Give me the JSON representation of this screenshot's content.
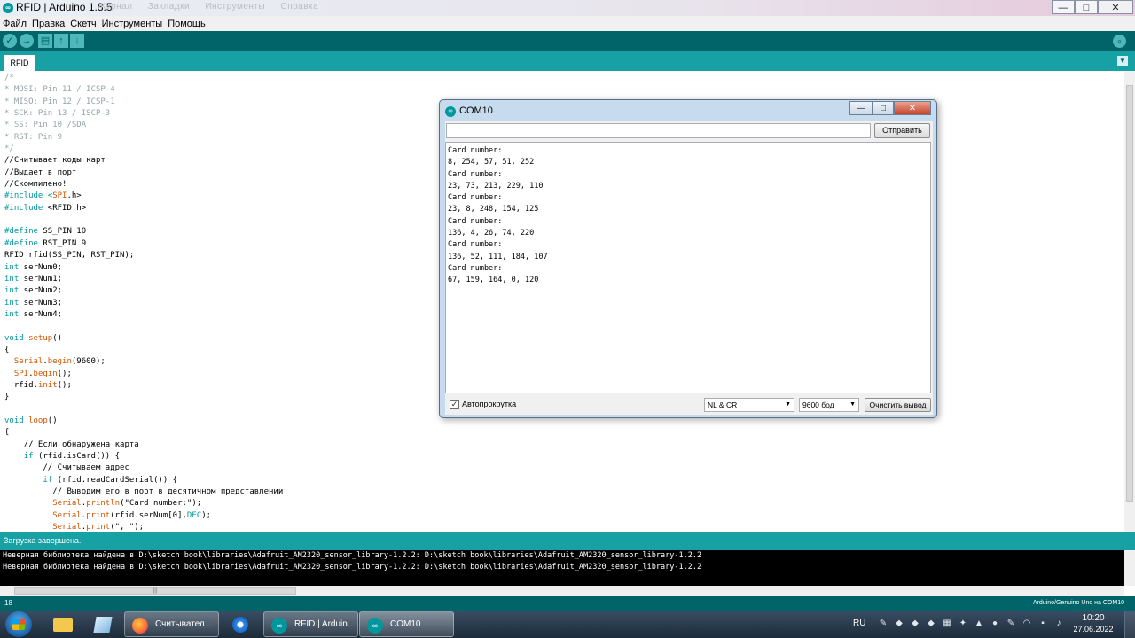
{
  "window": {
    "title": "RFID | Arduino 1.8.5",
    "ghost_menu": [
      "Журнал",
      "Закладки",
      "Инструменты",
      "Справка"
    ],
    "controls": {
      "minimize": "—",
      "maximize": "□",
      "close": "✕"
    }
  },
  "menu": [
    "Файл",
    "Правка",
    "Скетч",
    "Инструменты",
    "Помощь"
  ],
  "toolbar": {
    "verify_glyph": "✓",
    "upload_glyph": "→",
    "new_glyph": "▤",
    "open_glyph": "↑",
    "save_glyph": "↓",
    "serial_glyph": "⌕"
  },
  "tab": {
    "label": "RFID",
    "menu_glyph": "▼"
  },
  "code_lines": [
    [
      {
        "t": "/*",
        "c": "comment"
      }
    ],
    [
      {
        "t": "* MOSI: Pin 11 / ICSP-4",
        "c": "comment"
      }
    ],
    [
      {
        "t": "* MISO: Pin 12 / ICSP-1",
        "c": "comment"
      }
    ],
    [
      {
        "t": "* SCK: Pin 13 / ISCP-3",
        "c": "comment"
      }
    ],
    [
      {
        "t": "* SS: Pin 10 /SDA",
        "c": "comment"
      }
    ],
    [
      {
        "t": "* RST: Pin 9",
        "c": "comment"
      }
    ],
    [
      {
        "t": "*/",
        "c": "comment"
      }
    ],
    [
      {
        "t": "//Считывает коды карт",
        "c": ""
      }
    ],
    [
      {
        "t": "//Выдает в порт",
        "c": ""
      }
    ],
    [
      {
        "t": "//Скомпилено!",
        "c": ""
      }
    ],
    [
      {
        "t": "#include <",
        "c": "kw"
      },
      {
        "t": "SPI",
        "c": "fn"
      },
      {
        "t": ".h>",
        "c": ""
      }
    ],
    [
      {
        "t": "#include ",
        "c": "kw"
      },
      {
        "t": "<RFID.h>",
        "c": ""
      }
    ],
    [
      {
        "t": "",
        "c": ""
      }
    ],
    [
      {
        "t": "#define ",
        "c": "kw"
      },
      {
        "t": "SS_PIN 10",
        "c": ""
      }
    ],
    [
      {
        "t": "#define ",
        "c": "kw"
      },
      {
        "t": "RST_PIN 9",
        "c": ""
      }
    ],
    [
      {
        "t": "RFID rfid(SS_PIN, RST_PIN);",
        "c": ""
      }
    ],
    [
      {
        "t": "int",
        "c": "kw"
      },
      {
        "t": " serNum0;",
        "c": ""
      }
    ],
    [
      {
        "t": "int",
        "c": "kw"
      },
      {
        "t": " serNum1;",
        "c": ""
      }
    ],
    [
      {
        "t": "int",
        "c": "kw"
      },
      {
        "t": " serNum2;",
        "c": ""
      }
    ],
    [
      {
        "t": "int",
        "c": "kw"
      },
      {
        "t": " serNum3;",
        "c": ""
      }
    ],
    [
      {
        "t": "int",
        "c": "kw"
      },
      {
        "t": " serNum4;",
        "c": ""
      }
    ],
    [
      {
        "t": "",
        "c": ""
      }
    ],
    [
      {
        "t": "void ",
        "c": "kw"
      },
      {
        "t": "setup",
        "c": "fn"
      },
      {
        "t": "()",
        "c": ""
      }
    ],
    [
      {
        "t": "{",
        "c": ""
      }
    ],
    [
      {
        "t": "  ",
        "c": ""
      },
      {
        "t": "Serial",
        "c": "fn"
      },
      {
        "t": ".",
        "c": ""
      },
      {
        "t": "begin",
        "c": "fn"
      },
      {
        "t": "(9600);",
        "c": ""
      }
    ],
    [
      {
        "t": "  ",
        "c": ""
      },
      {
        "t": "SPI",
        "c": "fn"
      },
      {
        "t": ".",
        "c": ""
      },
      {
        "t": "begin",
        "c": "fn"
      },
      {
        "t": "();",
        "c": ""
      }
    ],
    [
      {
        "t": "  rfid.",
        "c": ""
      },
      {
        "t": "init",
        "c": "fn"
      },
      {
        "t": "();",
        "c": ""
      }
    ],
    [
      {
        "t": "}",
        "c": ""
      }
    ],
    [
      {
        "t": "",
        "c": ""
      }
    ],
    [
      {
        "t": "void ",
        "c": "kw"
      },
      {
        "t": "loop",
        "c": "fn"
      },
      {
        "t": "()",
        "c": ""
      }
    ],
    [
      {
        "t": "{",
        "c": ""
      }
    ],
    [
      {
        "t": "    // Если обнаружена карта",
        "c": ""
      }
    ],
    [
      {
        "t": "    ",
        "c": ""
      },
      {
        "t": "if",
        "c": "kw"
      },
      {
        "t": " (rfid.isCard()) {",
        "c": ""
      }
    ],
    [
      {
        "t": "        // Считываем адрес",
        "c": ""
      }
    ],
    [
      {
        "t": "        ",
        "c": ""
      },
      {
        "t": "if",
        "c": "kw"
      },
      {
        "t": " (rfid.readCardSerial()) {",
        "c": ""
      }
    ],
    [
      {
        "t": "          // Выводим его в порт в десятичном представлении",
        "c": ""
      }
    ],
    [
      {
        "t": "          ",
        "c": ""
      },
      {
        "t": "Serial",
        "c": "fn"
      },
      {
        "t": ".",
        "c": ""
      },
      {
        "t": "println",
        "c": "fn"
      },
      {
        "t": "(\"Card number:\");",
        "c": ""
      }
    ],
    [
      {
        "t": "          ",
        "c": ""
      },
      {
        "t": "Serial",
        "c": "fn"
      },
      {
        "t": ".",
        "c": ""
      },
      {
        "t": "print",
        "c": "fn"
      },
      {
        "t": "(rfid.serNum[0],",
        "c": ""
      },
      {
        "t": "DEC",
        "c": "kw"
      },
      {
        "t": ");",
        "c": ""
      }
    ],
    [
      {
        "t": "          ",
        "c": ""
      },
      {
        "t": "Serial",
        "c": "fn"
      },
      {
        "t": ".",
        "c": ""
      },
      {
        "t": "print",
        "c": "fn"
      },
      {
        "t": "(\", \");",
        "c": ""
      }
    ]
  ],
  "status": {
    "message": "Загрузка завершена."
  },
  "console_lines": [
    "Неверная библиотека найдена в D:\\sketch book\\libraries\\Adafruit_AM2320_sensor_library-1.2.2: D:\\sketch book\\libraries\\Adafruit_AM2320_sensor_library-1.2.2",
    "Неверная библиотека найдена в D:\\sketch book\\libraries\\Adafruit_AM2320_sensor_library-1.2.2: D:\\sketch book\\libraries\\Adafruit_AM2320_sensor_library-1.2.2"
  ],
  "hscroll_grip": "|||",
  "footer": {
    "line_number": "18",
    "board": "Arduino/Genuino Uno на COM10"
  },
  "serial_monitor": {
    "title": "COM10",
    "input_value": "",
    "send_label": "Отправить",
    "output_lines": [
      "Card number:",
      "8, 254, 57, 51, 252",
      "Card number:",
      "23, 73, 213, 229, 110",
      "Card number:",
      "23, 8, 248, 154, 125",
      "Card number:",
      "136, 4, 26, 74, 220",
      "Card number:",
      "136, 52, 111, 184, 107",
      "Card number:",
      "67, 159, 164, 0, 120"
    ],
    "autoscroll_label": "Автопрокрутка",
    "autoscroll_checked_glyph": "✓",
    "line_ending": "NL & CR",
    "baud": "9600 бод",
    "clear_label": "Очистить вывод",
    "dropdown_glyph": "▼"
  },
  "taskbar": {
    "items": [
      {
        "label": "Считывател...",
        "icon": "firefox-icon"
      },
      {
        "label": "",
        "icon": "edge-icon"
      },
      {
        "label": "RFID | Arduin...",
        "icon": "arduino-icon"
      },
      {
        "label": "COM10",
        "icon": "arduino-icon"
      }
    ],
    "language": "RU",
    "time": "10:20",
    "date": "27.06.2022"
  },
  "colors": {
    "arduino_teal": "#00979c",
    "toolbar_dark": "#006468",
    "tab_strip": "#17a1a5",
    "comment": "#95a5a6",
    "keyword": "#00979c",
    "function": "#d35400"
  }
}
